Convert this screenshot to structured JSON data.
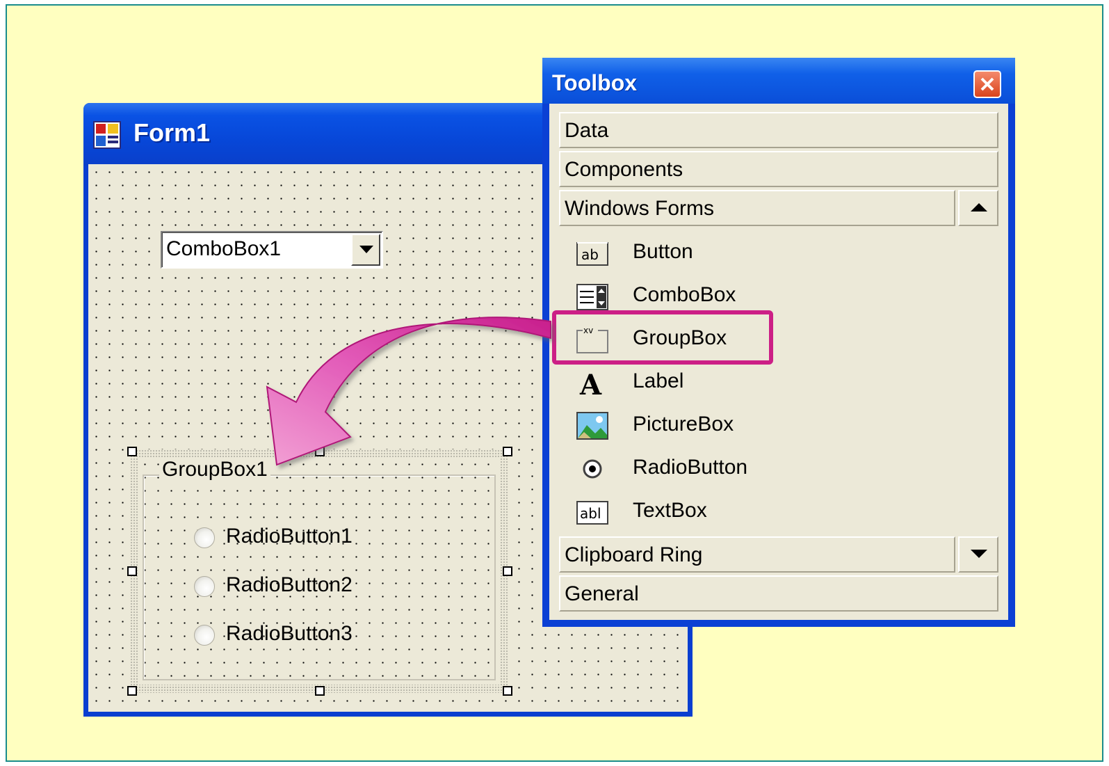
{
  "form": {
    "title": "Form1",
    "combobox_text": "ComboBox1",
    "groupbox_label": "GroupBox1",
    "radio_buttons": [
      "RadioButton1",
      "RadioButton2",
      "RadioButton3"
    ]
  },
  "toolbox": {
    "title": "Toolbox",
    "tabs_top": [
      "Data",
      "Components",
      "Windows Forms"
    ],
    "items": [
      {
        "label": "Button",
        "icon": "button-icon"
      },
      {
        "label": "ComboBox",
        "icon": "combobox-icon"
      },
      {
        "label": "GroupBox",
        "icon": "groupbox-icon"
      },
      {
        "label": "Label",
        "icon": "label-icon"
      },
      {
        "label": "PictureBox",
        "icon": "picturebox-icon"
      },
      {
        "label": "RadioButton",
        "icon": "radiobutton-icon"
      },
      {
        "label": "TextBox",
        "icon": "textbox-icon"
      }
    ],
    "tabs_bottom": [
      "Clipboard Ring",
      "General"
    ],
    "highlighted_item": "GroupBox"
  },
  "colors": {
    "slide_background": "#ffffc0",
    "slide_border": "#1a8c8c",
    "xp_title_blue": "#0a52e4",
    "highlight_magenta": "#cc1f86",
    "arrow_pink": "#e040a8"
  }
}
